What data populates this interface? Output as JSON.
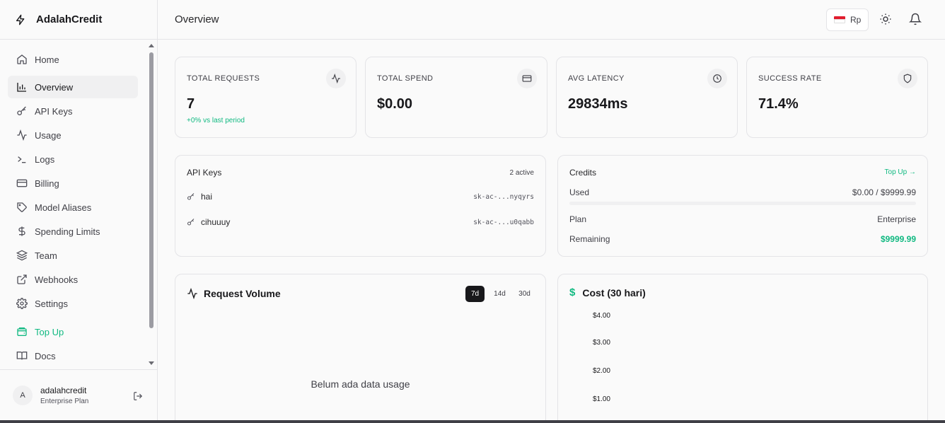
{
  "app": {
    "name": "AdalahCredit",
    "logo_icon": "zap-icon"
  },
  "sidebar": {
    "items": [
      {
        "label": "Home",
        "icon": "home-icon"
      },
      {
        "label": "Overview",
        "icon": "bar-chart-icon",
        "active": true
      },
      {
        "label": "API Keys",
        "icon": "key-icon"
      },
      {
        "label": "Usage",
        "icon": "activity-icon"
      },
      {
        "label": "Logs",
        "icon": "terminal-icon"
      },
      {
        "label": "Billing",
        "icon": "credit-card-icon"
      },
      {
        "label": "Model Aliases",
        "icon": "tag-icon"
      },
      {
        "label": "Spending Limits",
        "icon": "dollar-icon"
      },
      {
        "label": "Team",
        "icon": "layers-icon"
      },
      {
        "label": "Webhooks",
        "icon": "external-link-icon"
      },
      {
        "label": "Settings",
        "icon": "gear-icon"
      },
      {
        "label": "Top Up",
        "icon": "wallet-icon",
        "accent": "#10b981"
      },
      {
        "label": "Docs",
        "icon": "book-icon"
      }
    ],
    "user": {
      "initial": "A",
      "name": "adalahcredit",
      "plan": "Enterprise Plan"
    }
  },
  "header": {
    "title": "Overview",
    "currency": "Rp",
    "theme_icon": "sun-icon",
    "notification_icon": "bell-icon"
  },
  "stats": [
    {
      "label": "TOTAL REQUESTS",
      "value": "7",
      "delta": "+0% vs last period",
      "icon": "activity-icon"
    },
    {
      "label": "TOTAL SPEND",
      "value": "$0.00",
      "icon": "credit-card-icon"
    },
    {
      "label": "AVG LATENCY",
      "value": "29834ms",
      "icon": "clock-icon"
    },
    {
      "label": "SUCCESS RATE",
      "value": "71.4%",
      "icon": "shield-icon"
    }
  ],
  "api_keys": {
    "title": "API Keys",
    "count": "2 active",
    "keys": [
      {
        "name": "hai",
        "masked": "sk-ac-...nyqyrs"
      },
      {
        "name": "cihuuuy",
        "masked": "sk-ac-...u0qabb"
      }
    ]
  },
  "credits": {
    "title": "Credits",
    "topup_label": "Top Up →",
    "used_label": "Used",
    "used_value": "$0.00 / $9999.99",
    "used_fraction": 0,
    "plan_label": "Plan",
    "plan_value": "Enterprise",
    "remaining_label": "Remaining",
    "remaining_value": "$9999.99"
  },
  "request_volume": {
    "title": "Request Volume",
    "ranges": [
      "7d",
      "14d",
      "30d"
    ],
    "active_range": "7d",
    "empty_text": "Belum ada data usage"
  },
  "cost": {
    "title": "Cost (30 hari)",
    "ticks": [
      "$4.00",
      "$3.00",
      "$2.00",
      "$1.00"
    ]
  },
  "colors": {
    "accent": "#10b981",
    "dark": "#18181b"
  }
}
